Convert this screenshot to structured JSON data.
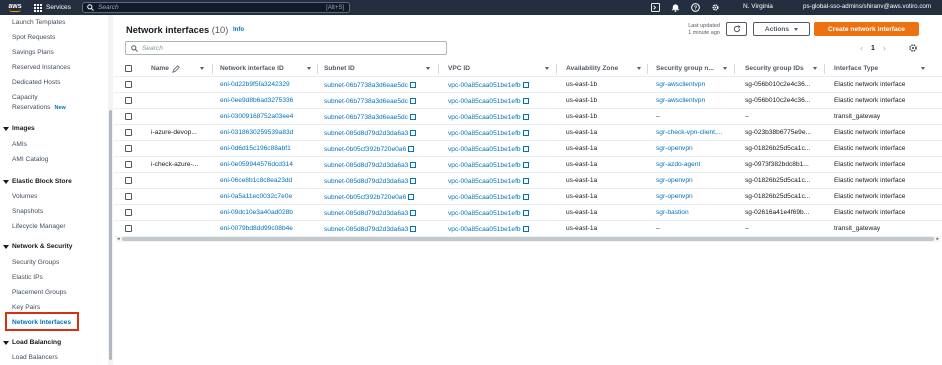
{
  "topnav": {
    "logo": "aws",
    "services_label": "Services",
    "search_placeholder": "Search",
    "search_shortcut": "[Alt+S]",
    "region": "N. Virginia",
    "account": "ps-global-sso-admins/shiranv@aws.votiro.com"
  },
  "sidebar": {
    "items_top": [
      "Launch Templates",
      "Spot Requests",
      "Savings Plans",
      "Reserved Instances",
      "Dedicated Hosts",
      "Capacity",
      "Reservations"
    ],
    "new_badge": "New",
    "images": {
      "title": "Images",
      "items": [
        "AMIs",
        "AMI Catalog"
      ]
    },
    "ebs": {
      "title": "Elastic Block Store",
      "items": [
        "Volumes",
        "Snapshots",
        "Lifecycle Manager"
      ]
    },
    "netsec": {
      "title": "Network & Security",
      "items": [
        "Security Groups",
        "Elastic IPs",
        "Placement Groups",
        "Key Pairs",
        "Network Interfaces"
      ]
    },
    "lb": {
      "title": "Load Balancing",
      "items": [
        "Load Balancers"
      ]
    }
  },
  "main": {
    "title": "Network interfaces",
    "count": "(10)",
    "info": "Info",
    "last_updated_label": "Last updated",
    "last_updated_value": "1 minute ago",
    "actions_label": "Actions",
    "create_label": "Create network interface",
    "filter_placeholder": "Search",
    "page_number": "1"
  },
  "table": {
    "columns": [
      "Name",
      "Network interface ID",
      "Subnet ID",
      "VPC ID",
      "Availability Zone",
      "Security group n...",
      "Security group IDs",
      "Interface Type"
    ],
    "rows": [
      {
        "name": "",
        "eni": "eni-0d22b9f5fa3242329",
        "subnet": "subnet-06b7738a3d6eae5dc",
        "vpc": "vpc-00a85caa051be1efb",
        "az": "us-east-1b",
        "sgname": "sgr-awsclientvpn",
        "sgid": "sg-056b010c2e4c36...",
        "type": "Elastic network interface"
      },
      {
        "name": "",
        "eni": "eni-0ee9d8b6ad3275336",
        "subnet": "subnet-06b7738a3d6eae5dc",
        "vpc": "vpc-00a85caa051be1efb",
        "az": "us-east-1b",
        "sgname": "sgr-awsclientvpn",
        "sgid": "sg-056b010c2e4c36...",
        "type": "Elastic network interface"
      },
      {
        "name": "",
        "eni": "eni-03009168752a03ee4",
        "subnet": "subnet-06b7738a3d6eae5dc",
        "vpc": "vpc-00a85caa051be1efb",
        "az": "us-east-1b",
        "sgname": "–",
        "sgid": "–",
        "type": "transit_gateway"
      },
      {
        "name": "i-azure-devop...",
        "eni": "eni-0318630259539a83d",
        "subnet": "subnet-085d8d79d2d3da6a3",
        "vpc": "vpc-00a85caa051be1efb",
        "az": "us-east-1a",
        "sgname": "sgr-check-vpn-client,...",
        "sgid": "sg-023b38b6775e9e...",
        "type": "Elastic network interface"
      },
      {
        "name": "",
        "eni": "eni-0d6d15c196c88abf1",
        "subnet": "subnet-0b05cf392b720e0a6",
        "vpc": "vpc-00a85caa051be1efb",
        "az": "us-east-1a",
        "sgname": "sgr-openvpn",
        "sgid": "sg-01826b25d5ca1c...",
        "type": "Elastic network interface"
      },
      {
        "name": "i-check-azure-...",
        "eni": "eni-0e059944576dcd314",
        "subnet": "subnet-085d8d79d2d3da6a3",
        "vpc": "vpc-00a85caa051be1efb",
        "az": "us-east-1a",
        "sgname": "sgr-azdo-agent",
        "sgid": "sg-0973f382bdc8b1...",
        "type": "Elastic network interface"
      },
      {
        "name": "",
        "eni": "eni-06ce8b1c8c8ea23dd",
        "subnet": "subnet-085d8d79d2d3da6a3",
        "vpc": "vpc-00a85caa051be1efb",
        "az": "us-east-1a",
        "sgname": "sgr-openvpn",
        "sgid": "sg-01826b25d5ca1c...",
        "type": "Elastic network interface"
      },
      {
        "name": "",
        "eni": "eni-0a5a11ec0032c7e0e",
        "subnet": "subnet-0b05cf392b720e0a6",
        "vpc": "vpc-00a85caa051be1efb",
        "az": "us-east-1a",
        "sgname": "sgr-openvpn",
        "sgid": "sg-01826b25d5ca1c...",
        "type": "Elastic network interface"
      },
      {
        "name": "",
        "eni": "eni-09dc10e3a40ad028b",
        "subnet": "subnet-085d8d79d2d3da6a3",
        "vpc": "vpc-00a85caa051be1efb",
        "az": "us-east-1a",
        "sgname": "sgr-bastion",
        "sgid": "sg-02616a41e4f69b...",
        "type": "Elastic network interface"
      },
      {
        "name": "",
        "eni": "eni-0079bd8dd99c08b4e",
        "subnet": "subnet-085d8d79d2d3da6a3",
        "vpc": "vpc-00a85caa051be1efb",
        "az": "us-east-1a",
        "sgname": "–",
        "sgid": "–",
        "type": "transit_gateway"
      }
    ]
  },
  "colors": {
    "nav_bg": "#232f3e",
    "accent": "#ec7211",
    "link": "#0073bb",
    "highlight": "#d13212"
  }
}
